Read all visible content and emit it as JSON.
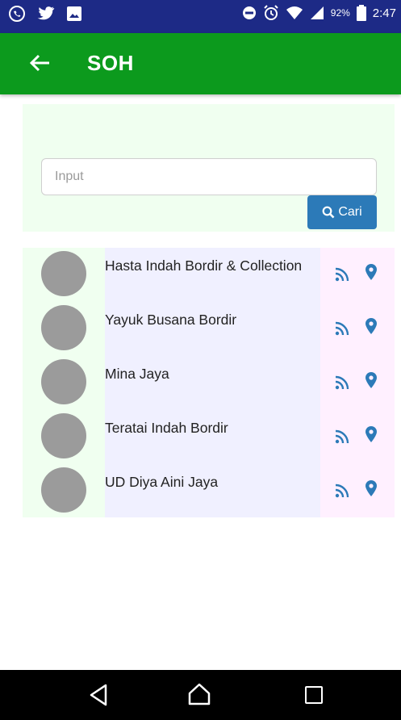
{
  "status_bar": {
    "battery_percent": "92%",
    "time": "2:47",
    "icons": [
      "whatsapp-icon",
      "twitter-icon",
      "image-icon",
      "do-not-disturb-icon",
      "alarm-icon",
      "wifi-icon",
      "signal-icon",
      "battery-icon"
    ]
  },
  "app_bar": {
    "title": "SOH",
    "back_icon": "arrow-left-icon",
    "color": "#0c9a1d"
  },
  "search": {
    "placeholder": "Input",
    "value": "",
    "button_label": "Cari",
    "button_icon": "search-icon",
    "button_color": "#2c7ab8"
  },
  "stores": [
    {
      "name": "Hasta Indah Bordir & Collection"
    },
    {
      "name": "Yayuk Busana Bordir"
    },
    {
      "name": "Mina Jaya"
    },
    {
      "name": "Teratai Indah Bordir"
    },
    {
      "name": "UD Diya Aini Jaya"
    }
  ],
  "row_icons": [
    "rss-icon",
    "map-pin-icon"
  ],
  "nav_bar": {
    "icons": [
      "back-triangle-icon",
      "home-icon",
      "recent-apps-icon"
    ]
  },
  "colors": {
    "status_bar": "#1d2a86",
    "icon_accent": "#2c7ab8"
  }
}
